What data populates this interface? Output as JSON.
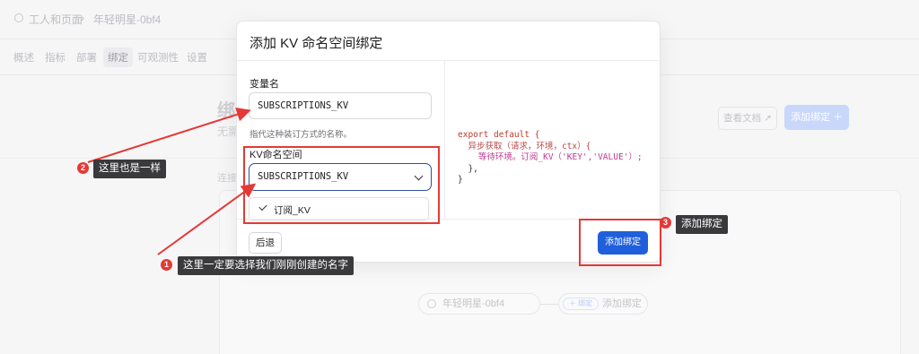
{
  "background": {
    "breadcrumb": [
      "工人和页面",
      "›",
      "年轻明星-0bf4"
    ],
    "tabs": [
      "概述",
      "指标",
      "部署",
      "绑定",
      "可观测性",
      "设置"
    ],
    "active_tab": "绑定",
    "page_title": "绑",
    "page_subtitle": "无需",
    "section_label": "连接",
    "docs_button": "查看文档 ↗",
    "add_binding_button": "添加绑定 ＋",
    "node_label": "年轻明星-0bf4",
    "bind_pill": "＋ 绑定",
    "bind_label": "添加绑定"
  },
  "modal": {
    "title": "添加 KV 命名空间绑定",
    "variable_label": "变量名",
    "variable_value": "SUBSCRIPTIONS_KV",
    "variable_hint": "指代这种装订方式的名称。",
    "namespace_label": "KV命名空间",
    "namespace_value": "SUBSCRIPTIONS_KV",
    "option_selected": "订阅_KV",
    "code_lines": [
      "export default {",
      "  异步获取（请求，环境，ctx）{",
      "    等待环境。订阅_KV（'KEY','VALUE'）;",
      "  },",
      "}"
    ],
    "back_button": "后退",
    "submit_button": "添加绑定"
  },
  "annotations": {
    "one": {
      "number": "1",
      "text": "这里一定要选择我们刚刚创建的名字"
    },
    "two": {
      "number": "2",
      "text": "这里也是一样"
    },
    "three": {
      "number": "3",
      "text": "添加绑定"
    }
  },
  "colors": {
    "primary": "#1f5fdb",
    "annotation_red": "#e53935",
    "tip_bg": "#3a3a3d"
  }
}
